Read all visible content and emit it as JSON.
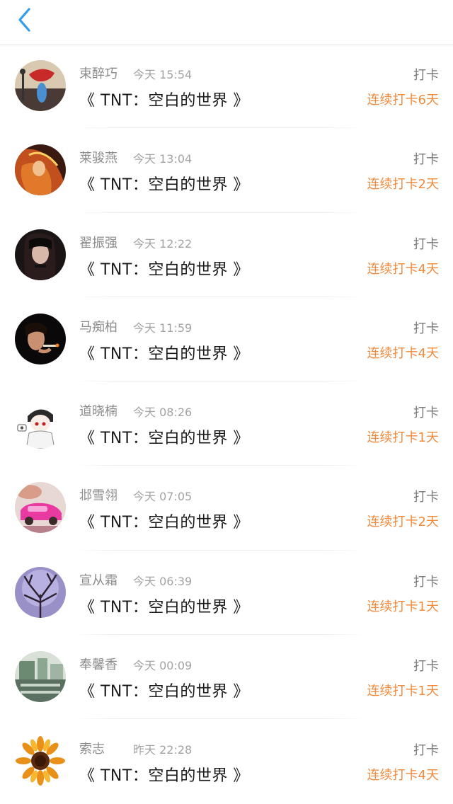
{
  "header": {
    "back_icon": "chevron-left-icon",
    "accent_color": "#2f9cf0"
  },
  "entries": [
    {
      "name": "束醉巧",
      "time": "今天 15:54",
      "title": "《 TNT：空白的世界 》",
      "checkin": "打卡",
      "streak": "连续打卡6天"
    },
    {
      "name": "莱骏燕",
      "time": "今天 13:04",
      "title": "《 TNT：空白的世界 》",
      "checkin": "打卡",
      "streak": "连续打卡2天"
    },
    {
      "name": "翟振强",
      "time": "今天 12:22",
      "title": "《 TNT：空白的世界 》",
      "checkin": "打卡",
      "streak": "连续打卡4天"
    },
    {
      "name": "马痴柏",
      "time": "今天 11:59",
      "title": "《 TNT：空白的世界 》",
      "checkin": "打卡",
      "streak": "连续打卡4天"
    },
    {
      "name": "道晓楠",
      "time": "今天 08:26",
      "title": "《 TNT：空白的世界 》",
      "checkin": "打卡",
      "streak": "连续打卡1天"
    },
    {
      "name": "邶雪翎",
      "time": "今天 07:05",
      "title": "《 TNT：空白的世界 》",
      "checkin": "打卡",
      "streak": "连续打卡2天"
    },
    {
      "name": "宣从霜",
      "time": "今天 06:39",
      "title": "《 TNT：空白的世界 》",
      "checkin": "打卡",
      "streak": "连续打卡1天"
    },
    {
      "name": "奉馨香",
      "time": "今天 00:09",
      "title": "《 TNT：空白的世界 》",
      "checkin": "打卡",
      "streak": "连续打卡1天"
    },
    {
      "name": "索志",
      "time": "昨天 22:28",
      "title": "《 TNT：空白的世界 》",
      "checkin": "打卡",
      "streak": "连续打卡4天"
    }
  ],
  "colors": {
    "streak": "#f08a3c",
    "name": "#8c8c8c",
    "title": "#1a1a1a"
  }
}
